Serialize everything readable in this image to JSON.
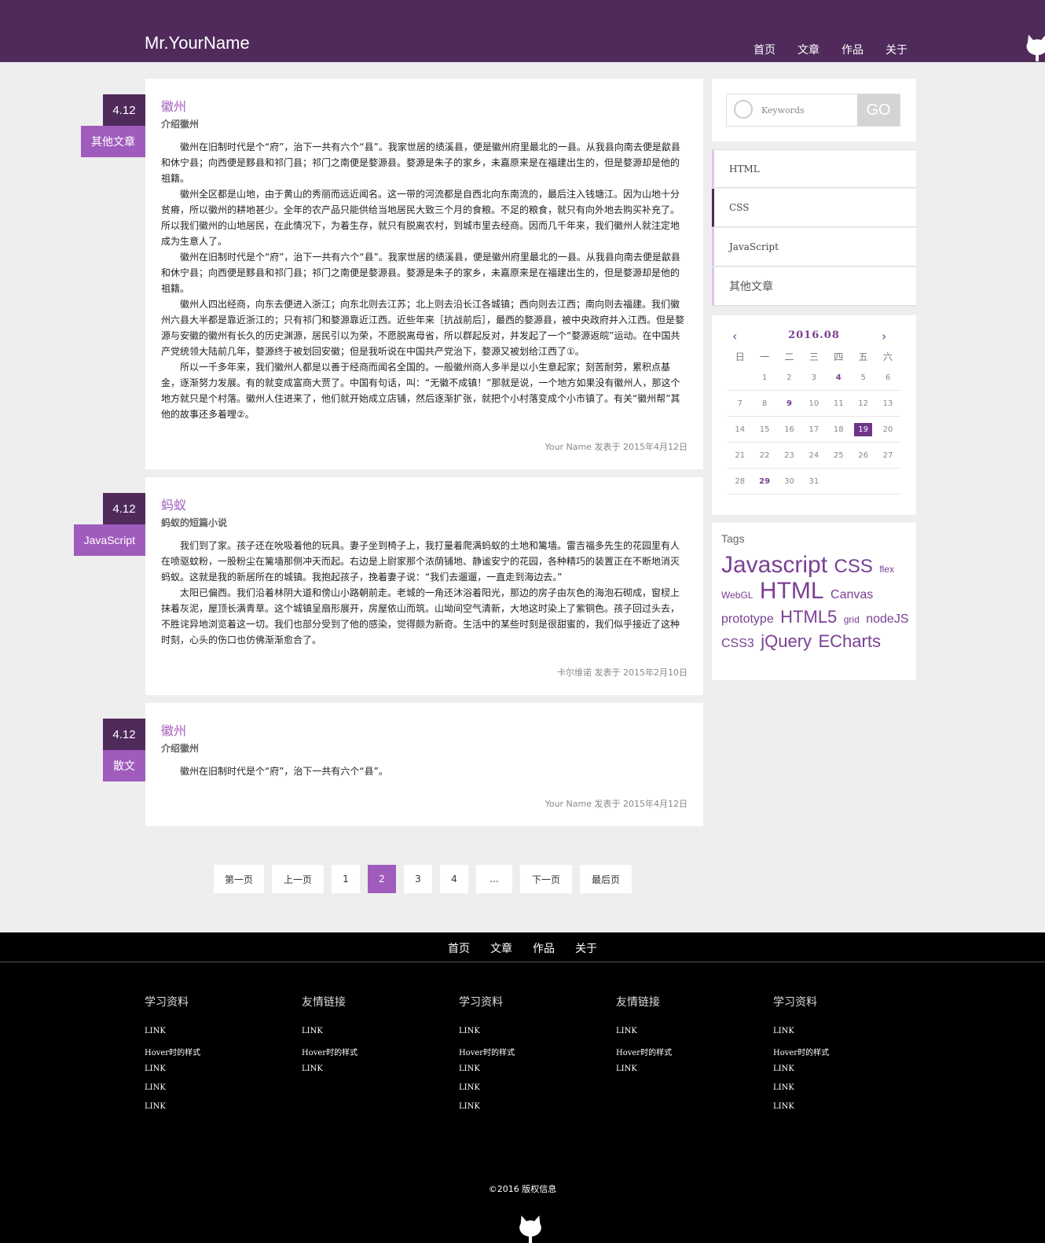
{
  "header": {
    "brand": "Mr.YourName",
    "nav": [
      "首页",
      "文章",
      "作品",
      "关于"
    ]
  },
  "articles": [
    {
      "date": "4.12",
      "category": "其他文章",
      "title": "徽州",
      "subtitle": "介绍徽州",
      "paragraphs": [
        "徽州在旧制时代是个“府”，治下一共有六个“县”。我家世居的绩溪县，便是徽州府里最北的一县。从我县向南去便是歙县和休宁县；向西便是黟县和祁门县；祁门之南便是婺源县。婺源是朱子的家乡，未嘉原来是在福建出生的，但是婺源却是他的祖籍。",
        "徽州全区都是山地，由于黄山的秀丽而远近闻名。这一带的河流都是自西北向东南流的，最后注入钱塘江。因为山地十分贫瘠，所以徽州的耕地甚少。全年的农产品只能供给当地居民大致三个月的食粮。不足的粮食，就只有向外地去购买补充了。所以我们徽州的山地居民，在此情况下，为着生存，就只有脱离农村，到城市里去经商。因而几千年来，我们徽州人就注定地成为生意人了。",
        "徽州在旧制时代是个“府”，治下一共有六个“县”。我家世居的绩溪县，便是徽州府里最北的一县。从我县向南去便是歙县和休宁县；向西便是黟县和祁门县；祁门之南便是婺源县。婺源是朱子的家乡，未嘉原来是在福建出生的，但是婺源却是他的祖籍。",
        "徽州人四出经商，向东去便进入浙江；向东北则去江苏；北上则去沿长江各城镇；西向则去江西；南向则去福建。我们徽州六县大半都是靠近浙江的；只有祁门和婺源靠近江西。近些年来［抗战前后］，最西的婺源县，被中央政府并入江西。但是婺源与安徽的徽州有长久的历史渊源，居民引以为荣，不愿脱离母省，所以群起反对，并发起了一个“婺源返皖”运动。在中国共产党统领大陆前几年，婺源终于被划回安徽；但是我听说在中国共产党治下，婺源又被划给江西了①。",
        "所以一千多年来，我们徽州人都是以善于经商而闻名全国的。一般徽州商人多半是以小生意起家；刻苦耐劳，累积点基金，逐渐努力发展。有的就变成富商大贾了。中国有句话，叫：“无徽不成镇！”那就是说，一个地方如果没有徽州人，那这个地方就只是个村落。徽州人住进来了，他们就开始成立店铺，然后逐渐扩张，就把个小村落变成个小市镇了。有关“徽州帮”其他的故事还多着哩②。"
      ],
      "meta": "Your Name 发表于 2015年4月12日"
    },
    {
      "date": "4.12",
      "category": "JavaScript",
      "title": "蚂蚁",
      "subtitle": "蚂蚁的短篇小说",
      "paragraphs": [
        "我们到了家。孩子还在吮吸着他的玩具。妻子坐到椅子上，我打量着爬满蚂蚁的土地和篱墙。雷吉福多先生的花园里有人在喷驱蚊粉，一股粉尘在篱墙那侧冲天而起。右边是上尉家那个浓荫铺地、静谧安宁的花园，各种精巧的装置正在不断地消灭蚂蚁。这就是我的新居所在的城镇。我抱起孩子，挽着妻子说：“我们去遛遛，一直走到海边去。”",
        "太阳已偏西。我们沿着林阴大道和傍山小路朝前走。老城的一角还沐浴着阳光，那边的房子由灰色的海泡石砌成，窗棂上抹着灰泥，屋顶长满青草。这个城镇呈扇形展开，房屋依山而筑。山坳间空气清新，大地这时染上了紫铜色。孩子回过头去，不胜诧异地浏览着这一切。我们也部分受到了他的感染，觉得颇为新奇。生活中的某些时刻是很甜蜜的，我们似乎接近了这种时刻，心头的伤口也仿佛渐渐愈合了。"
      ],
      "meta": "卡尔维诺 发表于 2015年2月10日"
    },
    {
      "date": "4.12",
      "category": "散文",
      "title": "徽州",
      "subtitle": "介绍徽州",
      "paragraphs": [
        "徽州在旧制时代是个“府”，治下一共有六个“县”。"
      ],
      "meta": "Your Name 发表于 2015年4月12日"
    }
  ],
  "sidebar": {
    "search": {
      "placeholder": "Keywords",
      "button": "GO"
    },
    "categories": [
      "HTML",
      "CSS",
      "JavaScript",
      "其他文章"
    ],
    "calendar": {
      "title": "2016.08",
      "prev": "‹",
      "next": "›",
      "weekdays": [
        "日",
        "一",
        "二",
        "三",
        "四",
        "五",
        "六"
      ],
      "weeks": [
        [
          "",
          "1",
          "2",
          "3",
          "4",
          "5",
          "6"
        ],
        [
          "7",
          "8",
          "9",
          "10",
          "11",
          "12",
          "13"
        ],
        [
          "14",
          "15",
          "16",
          "17",
          "18",
          "19",
          "20"
        ],
        [
          "21",
          "22",
          "23",
          "24",
          "25",
          "26",
          "27"
        ],
        [
          "28",
          "29",
          "30",
          "31",
          "",
          "",
          ""
        ]
      ],
      "highlighted": [
        "4",
        "9",
        "29"
      ],
      "today": "19"
    },
    "tags": {
      "title": "Tags",
      "items": [
        {
          "text": "Javascript",
          "size": 30
        },
        {
          "text": "CSS",
          "size": 24
        },
        {
          "text": "flex",
          "size": 12
        },
        {
          "text": "WebGL",
          "size": 12
        },
        {
          "text": "HTML",
          "size": 30
        },
        {
          "text": "Canvas",
          "size": 16
        },
        {
          "text": "prototype",
          "size": 16
        },
        {
          "text": "HTML5",
          "size": 22
        },
        {
          "text": "grid",
          "size": 12
        },
        {
          "text": "nodeJS",
          "size": 16
        },
        {
          "text": "CSS3",
          "size": 16
        },
        {
          "text": "jQuery",
          "size": 22
        },
        {
          "text": "ECharts",
          "size": 22
        }
      ]
    }
  },
  "pagination": {
    "items": [
      "第一页",
      "上一页",
      "1",
      "2",
      "3",
      "4",
      "...",
      "下一页",
      "最后页"
    ],
    "active": "2"
  },
  "footer": {
    "nav": [
      "首页",
      "文章",
      "作品",
      "关于"
    ],
    "columns": [
      {
        "heading": "学习资料",
        "links": [
          "LINK",
          "Hover时的样式",
          "LINK",
          "LINK",
          "LINK"
        ]
      },
      {
        "heading": "友情链接",
        "links": [
          "LINK",
          "Hover时的样式",
          "LINK"
        ]
      },
      {
        "heading": "学习资料",
        "links": [
          "LINK",
          "Hover时的样式",
          "LINK",
          "LINK",
          "LINK"
        ]
      },
      {
        "heading": "友情链接",
        "links": [
          "LINK",
          "Hover时的样式",
          "LINK"
        ]
      },
      {
        "heading": "学习资料",
        "links": [
          "LINK",
          "Hover时的样式",
          "LINK",
          "LINK",
          "LINK"
        ]
      }
    ],
    "copyright": "©2016 版权信息"
  },
  "colors": {
    "primary": "#4f2a5b",
    "accent": "#a05cbd",
    "footer": "#000000"
  }
}
